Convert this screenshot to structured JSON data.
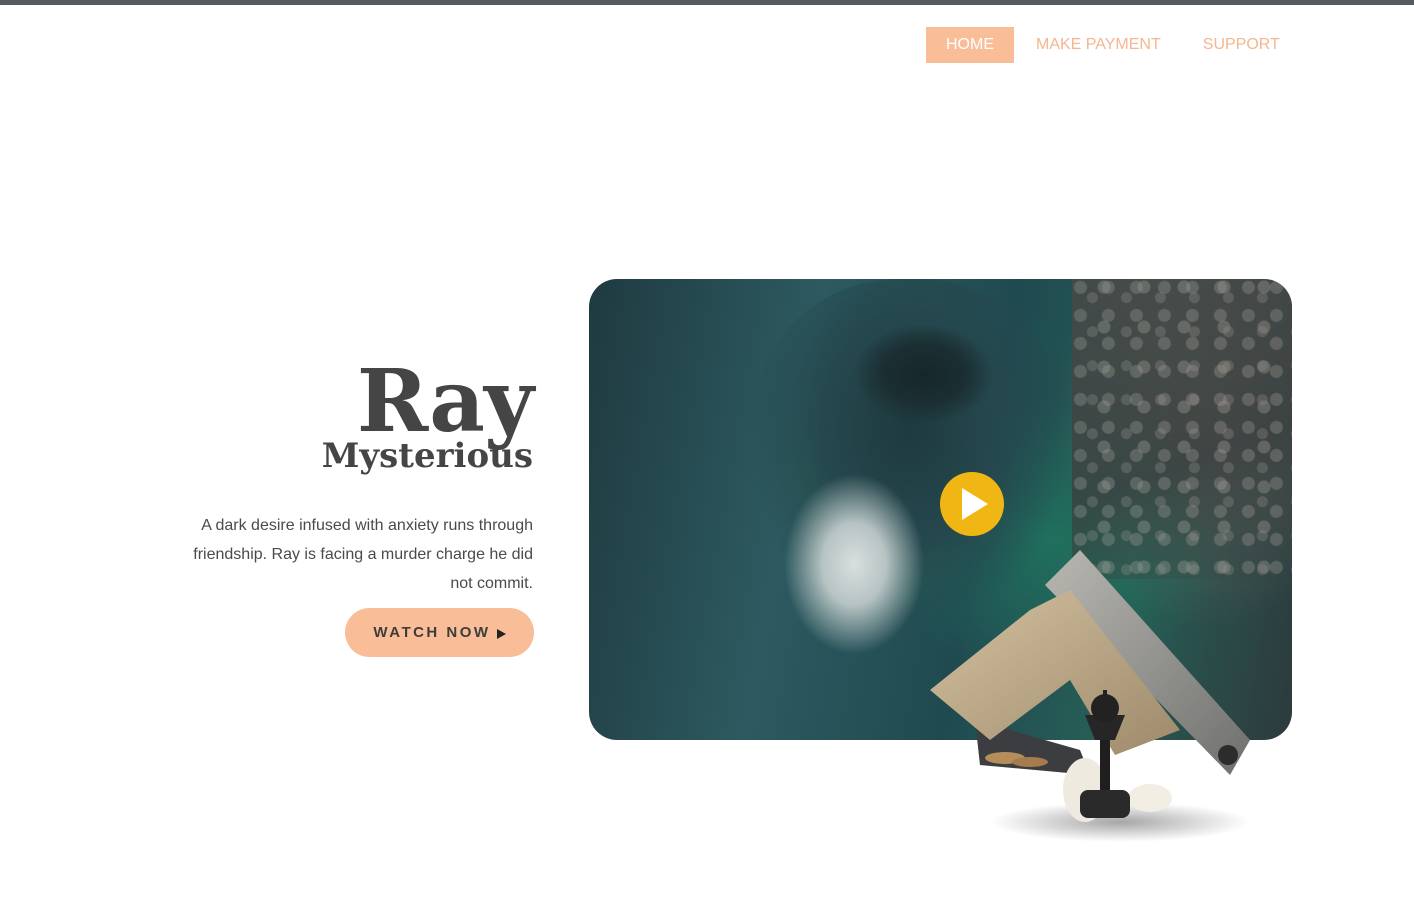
{
  "nav": {
    "items": [
      {
        "label": "HOME",
        "active": true
      },
      {
        "label": "MAKE PAYMENT",
        "active": false
      },
      {
        "label": "SUPPORT",
        "active": false
      }
    ]
  },
  "hero": {
    "title": "Ray",
    "subtitle": "Mysterious",
    "description": "A dark desire infused with anxiety runs through friendship. Ray is facing a murder charge he did not commit.",
    "cta_label": "WATCH NOW",
    "cta_icon": "play-arrow-icon"
  },
  "video": {
    "play_icon": "play-icon"
  },
  "colors": {
    "accent": "#f9bd98",
    "nav_text": "#f6b58f",
    "play_button": "#f0b714",
    "heading": "#454545",
    "topbar": "#555a60"
  }
}
